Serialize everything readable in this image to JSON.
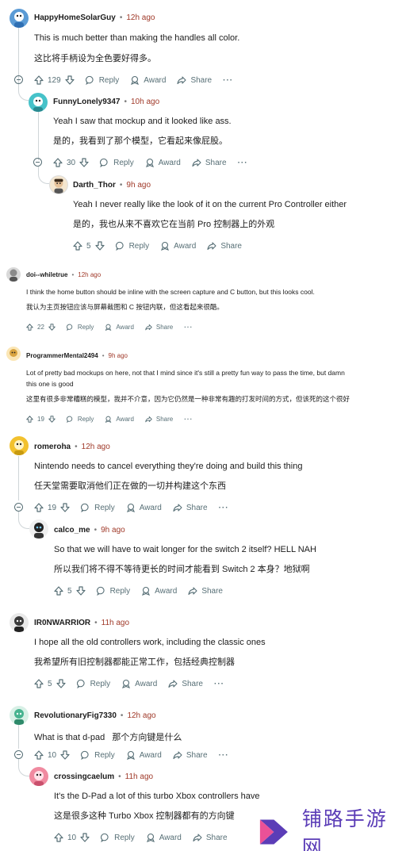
{
  "comments": [
    {
      "user": "HappyHomeSolarGuy",
      "time": "12h ago",
      "text_en": "This is much better than making the handles all color.",
      "text_zh": "这比将手柄设为全色要好得多。",
      "votes": "129",
      "avatar_color": "#5b9bd5",
      "actions": {
        "reply": "Reply",
        "award": "Award",
        "share": "Share",
        "more": "···"
      }
    },
    {
      "user": "FunnyLonely9347",
      "time": "10h ago",
      "text_en": "Yeah I saw that mockup and it looked like ass.",
      "text_zh": "是的，我看到了那个模型，它看起来像屁股。",
      "votes": "30",
      "avatar_color": "#46c2c9",
      "actions": {
        "reply": "Reply",
        "award": "Award",
        "share": "Share",
        "more": "···"
      }
    },
    {
      "user": "Darth_Thor",
      "time": "9h ago",
      "text_en": "Yeah I never really like the look of it on the current Pro Controller either",
      "text_zh": "是的，我也从来不喜欢它在当前 Pro 控制器上的外观",
      "votes": "5",
      "avatar_color": "#e8c39a",
      "actions": {
        "reply": "Reply",
        "award": "Award",
        "share": "Share"
      }
    },
    {
      "user": "doi--whiletrue",
      "time": "12h ago",
      "text_en": "I think the home button should be inline with the screen capture and C button, but this looks cool.",
      "text_zh": "我认为主页按钮应该与屏幕截图和 C 按钮内联，但这看起来很酷。",
      "votes": "22",
      "avatar_color": "#8a8a8a",
      "actions": {
        "reply": "Reply",
        "award": "Award",
        "share": "Share",
        "more": "···"
      }
    },
    {
      "user": "ProgrammerMental2494",
      "time": "9h ago",
      "text_en_1": "Lot of pretty bad mockups on here, not that I mind since it's still a pretty fun way to pass the time, but damn",
      "text_en_2": "this one is good",
      "text_zh": "这里有很多非常糟糕的模型，我并不介意，因为它仍然是一种非常有趣的打发时间的方式，但该死的这个很好",
      "votes": "19",
      "avatar_color": "#d9a441",
      "actions": {
        "reply": "Reply",
        "award": "Award",
        "share": "Share",
        "more": "···"
      }
    },
    {
      "user": "romeroha",
      "time": "12h ago",
      "text_en": "Nintendo needs to cancel everything they're doing and build this thing",
      "text_zh": "任天堂需要取消他们正在做的一切并构建这个东西",
      "votes": "19",
      "avatar_color": "#f2c12e",
      "actions": {
        "reply": "Reply",
        "award": "Award",
        "share": "Share",
        "more": "···"
      }
    },
    {
      "user": "calco_me",
      "time": "9h ago",
      "text_en": "So that we will have to wait longer for the switch 2 itself? HELL NAH",
      "text_zh": "所以我们将不得不等待更长的时间才能看到 Switch 2 本身？地狱啊",
      "votes": "5",
      "avatar_color": "#222222",
      "actions": {
        "reply": "Reply",
        "award": "Award",
        "share": "Share"
      }
    },
    {
      "user": "IR0NWARRIOR",
      "time": "11h ago",
      "text_en": "I hope all the old controllers work, including the classic ones",
      "text_zh": "我希望所有旧控制器都能正常工作，包括经典控制器",
      "votes": "5",
      "avatar_color": "#3a3a3a",
      "actions": {
        "reply": "Reply",
        "award": "Award",
        "share": "Share",
        "more": "···"
      }
    },
    {
      "user": "RevolutionaryFig7330",
      "time": "12h ago",
      "text_en": "What is that d-pad   那个方向键是什么",
      "votes": "10",
      "avatar_color": "#46b38f",
      "actions": {
        "reply": "Reply",
        "award": "Award",
        "share": "Share",
        "more": "···"
      }
    },
    {
      "user": "crossingcaelum",
      "time": "11h ago",
      "text_en": "It's the D-Pad a lot of this turbo Xbox controllers have",
      "text_zh": "这是很多这种 Turbo Xbox 控制器都有的方向键",
      "votes": "10",
      "avatar_color": "#f08aa0",
      "actions": {
        "reply": "Reply",
        "award": "Award",
        "share": "Share"
      }
    }
  ],
  "watermark": {
    "text": "铺路手游网",
    "color": "#5b3db7",
    "accent": "#e83e8c"
  },
  "icons": {
    "upvote": "arrow-up-icon",
    "downvote": "arrow-down-icon",
    "reply": "comment-bubble-icon",
    "award": "award-icon",
    "share": "share-arrow-icon",
    "collapse": "minus-circle-icon"
  }
}
